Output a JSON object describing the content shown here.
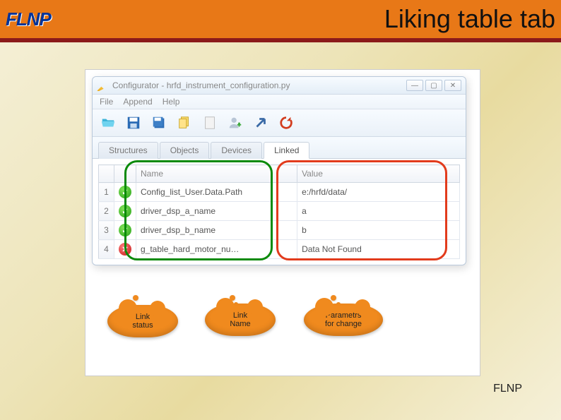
{
  "slide": {
    "title": "Liking table tab",
    "logo_text": "FLNP",
    "footer": "FLNP"
  },
  "window": {
    "title": "Configurator - hrfd_instrument_configuration.py",
    "menu": [
      "File",
      "Append",
      "Help"
    ],
    "tabs": [
      {
        "label": "Structures",
        "active": false
      },
      {
        "label": "Objects",
        "active": false
      },
      {
        "label": "Devices",
        "active": false
      },
      {
        "label": "Linked",
        "active": true
      }
    ],
    "columns": {
      "name": "Name",
      "value": "Value"
    },
    "rows": [
      {
        "num": "1",
        "ok": true,
        "name": "Config_list_User.Data.Path",
        "value": "e:/hrfd/data/"
      },
      {
        "num": "2",
        "ok": true,
        "name": "driver_dsp_a_name",
        "value": "a"
      },
      {
        "num": "3",
        "ok": true,
        "name": "driver_dsp_b_name",
        "value": "b"
      },
      {
        "num": "4",
        "ok": false,
        "name": "g_table_hard_motor_nu…",
        "value": "Data Not Found"
      }
    ]
  },
  "annotations": {
    "link_status": "Link\nstatus",
    "link_name": "Link\nName",
    "params": "Parametrs\nfor change"
  }
}
